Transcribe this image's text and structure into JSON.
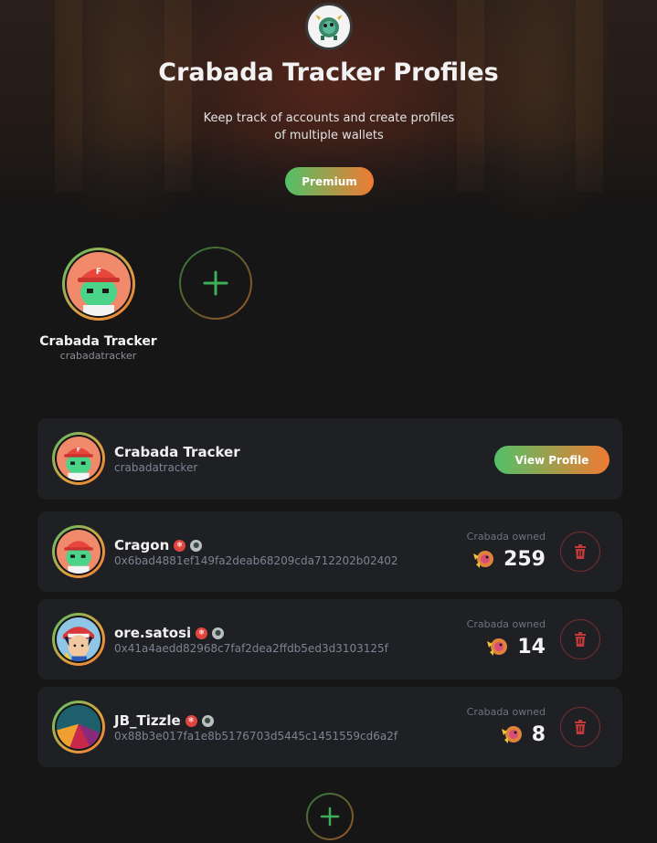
{
  "hero": {
    "title": "Crabada Tracker Profiles",
    "subtitle": "Keep track of accounts and create profiles of multiple wallets",
    "premium_label": "Premium"
  },
  "switcher": {
    "active_profile": {
      "name": "Crabada Tracker",
      "handle": "crabadatracker"
    }
  },
  "current_profile": {
    "name": "Crabada Tracker",
    "handle": "crabadatracker",
    "view_label": "View Profile"
  },
  "wallets": [
    {
      "name": "Cragon",
      "address": "0x6bad4881ef149fa2deab68209cda712202b02402",
      "owned_label": "Crabada owned",
      "owned_count": "259",
      "avatar": "crab-cap"
    },
    {
      "name": "ore.satosi",
      "address": "0x41a4aedd82968c7faf2dea2ffdb5ed3d3103125f",
      "owned_label": "Crabada owned",
      "owned_count": "14",
      "avatar": "anime-trainer"
    },
    {
      "name": "JB_Tizzle",
      "address": "0x88b3e017fa1e8b5176703d5445c1451559cd6a2f",
      "owned_label": "Crabada owned",
      "owned_count": "8",
      "avatar": "geometric"
    }
  ],
  "colors": {
    "accent_green": "#52c167",
    "accent_orange": "#f07a33",
    "card_bg": "#1f2024",
    "page_bg": "#161616",
    "danger": "#c0393b"
  }
}
